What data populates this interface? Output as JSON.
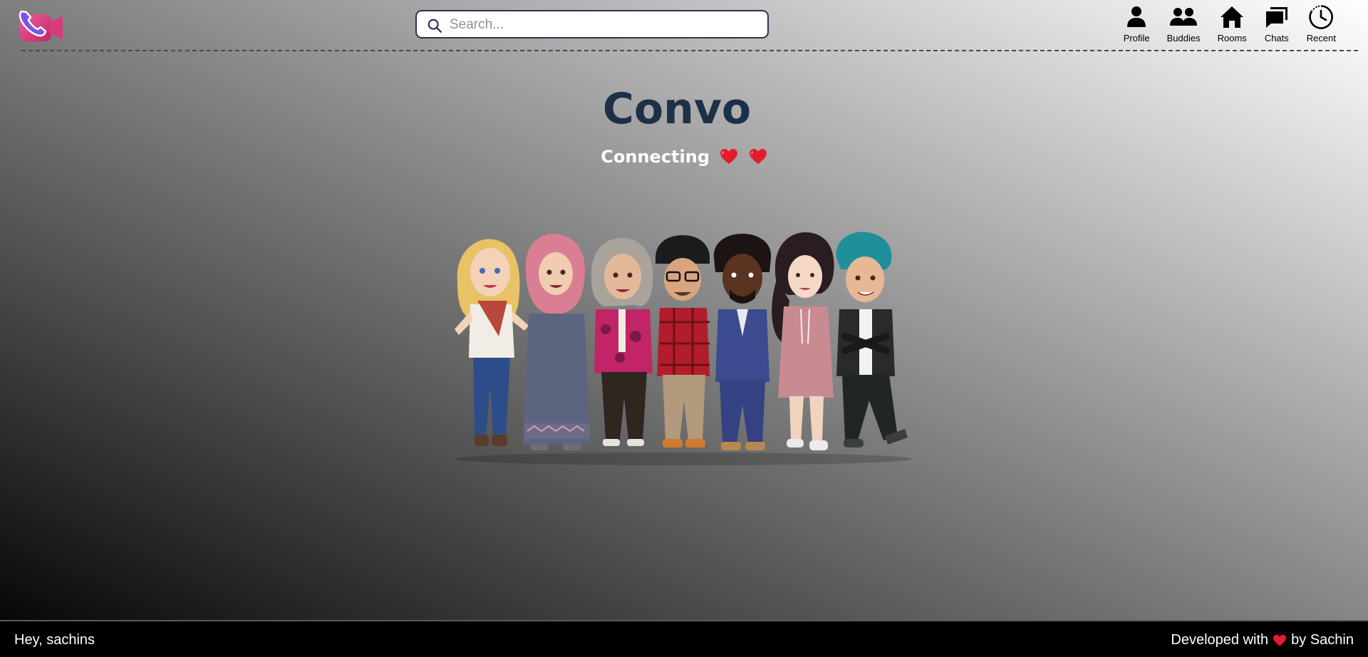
{
  "header": {
    "search": {
      "placeholder": "Search...",
      "value": ""
    },
    "nav": [
      {
        "label": "Profile",
        "icon": "person-icon"
      },
      {
        "label": "Buddies",
        "icon": "people-icon"
      },
      {
        "label": "Rooms",
        "icon": "home-icon"
      },
      {
        "label": "Chats",
        "icon": "chat-bubbles-icon"
      },
      {
        "label": "Recent",
        "icon": "clock-icon"
      }
    ]
  },
  "hero": {
    "title": "Convo",
    "subtitle": "Connecting"
  },
  "footer": {
    "greeting": "Hey, sachins",
    "credit_prefix": "Developed with",
    "credit_suffix": "by Sachin"
  },
  "colors": {
    "title": "#1e2f48",
    "heart": "#e41b2c",
    "logo_primary": "#e43f8a",
    "logo_secondary": "#7b4fd6"
  }
}
